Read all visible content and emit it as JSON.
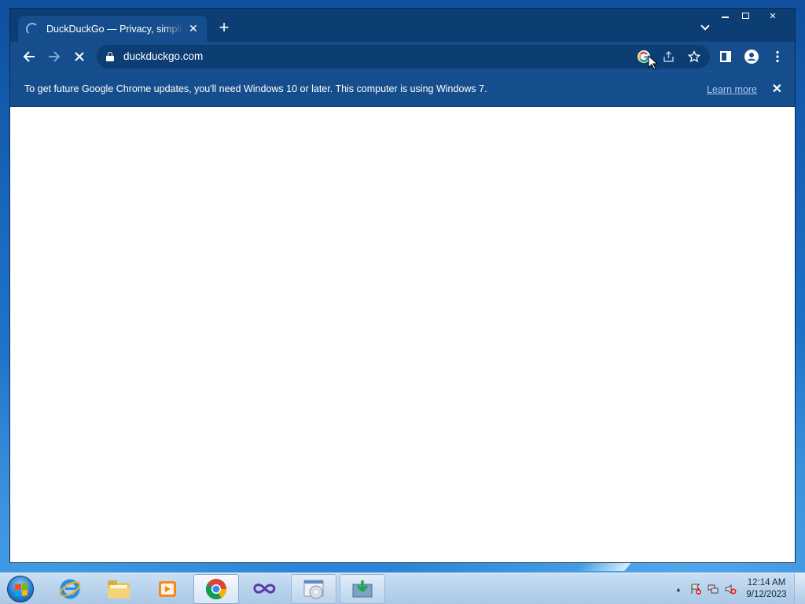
{
  "browser": {
    "tab": {
      "title": "DuckDuckGo — Privacy, simplified.",
      "close_symbol": "✕"
    },
    "new_tab_symbol": "+",
    "window_controls": {
      "close_symbol": "✕"
    },
    "omnibox": {
      "url": "duckduckgo.com"
    },
    "infobar": {
      "message": "To get future Google Chrome updates, you'll need Windows 10 or later. This computer is using Windows 7.",
      "learn_more": "Learn more",
      "close_symbol": "✕"
    },
    "toolbar_icons": [
      "back-icon",
      "forward-icon",
      "stop-loading-icon",
      "google-lens-icon",
      "share-icon",
      "bookmark-star-icon",
      "side-panel-icon",
      "profile-icon",
      "menu-icon"
    ]
  },
  "taskbar": {
    "apps": [
      "internet-explorer-icon",
      "file-explorer-icon",
      "media-player-icon",
      "chrome-icon",
      "infinity-app-icon",
      "disc-app-icon",
      "download-app-icon"
    ],
    "clock": {
      "time": "12:14 AM",
      "date": "9/12/2023"
    },
    "tray_expand_symbol": "▲"
  },
  "colors": {
    "window_frame": "#0c3d73",
    "toolbar": "#164d8c",
    "link": "#a8c8f0"
  }
}
